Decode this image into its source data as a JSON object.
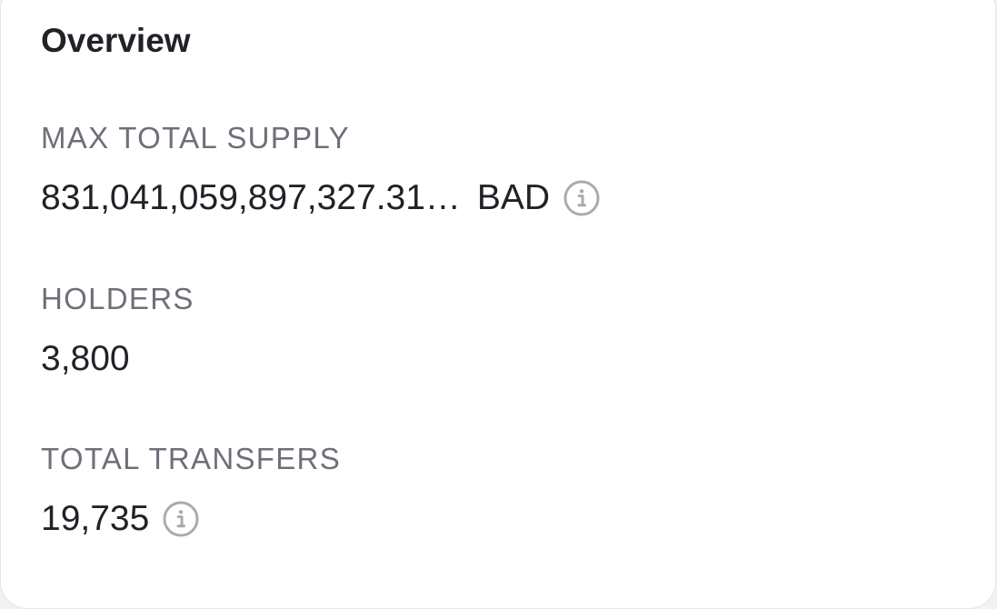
{
  "overview": {
    "title": "Overview",
    "max_total_supply": {
      "label": "MAX TOTAL SUPPLY",
      "value": "831,041,059,897,327.31…",
      "symbol": "BAD",
      "icon": "info-icon"
    },
    "holders": {
      "label": "HOLDERS",
      "value": "3,800"
    },
    "total_transfers": {
      "label": "TOTAL TRANSFERS",
      "value": "19,735",
      "icon": "info-icon"
    }
  },
  "colors": {
    "text_primary": "#1f2226",
    "text_label": "#6d7078",
    "icon": "#a7abb1",
    "card_bg": "#ffffff",
    "page_bg": "#f1f2f4"
  }
}
